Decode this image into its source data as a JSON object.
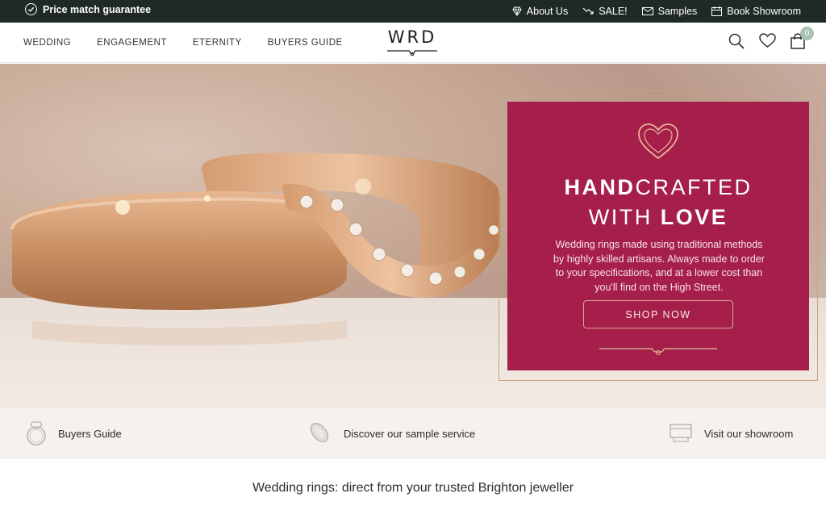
{
  "topbar": {
    "guarantee": "Price match guarantee",
    "links": [
      {
        "icon": "diamond-ring-icon",
        "label": "About Us"
      },
      {
        "icon": "trend-down-icon",
        "label": "SALE!"
      },
      {
        "icon": "envelope-icon",
        "label": "Samples"
      },
      {
        "icon": "calendar-icon",
        "label": "Book Showroom"
      }
    ]
  },
  "nav": {
    "links": [
      "WEDDING",
      "ENGAGEMENT",
      "ETERNITY",
      "BUYERS GUIDE"
    ],
    "logo": "WRD",
    "cart_count": "0",
    "icons": [
      "search-icon",
      "heart-icon",
      "bag-icon"
    ]
  },
  "hero": {
    "title_bold_1": "HAND",
    "title_light_1": "CRAFTED",
    "title_light_2": "WITH ",
    "title_bold_2": "LOVE",
    "description": "Wedding rings made using traditional methods by highly skilled artisans. Always made to order to your specifications, and at a lower cost than you'll find on the High Street.",
    "cta": "SHOP NOW",
    "colors": {
      "panel": "#a51f4a",
      "accent": "#c9a47c"
    }
  },
  "features": [
    {
      "icon": "ring-icon",
      "label": "Buyers Guide"
    },
    {
      "icon": "sample-ring-icon",
      "label": "Discover our sample service"
    },
    {
      "icon": "showroom-icon",
      "label": "Visit our showroom"
    }
  ],
  "tagline": "Wedding rings: direct from your trusted Brighton jeweller"
}
